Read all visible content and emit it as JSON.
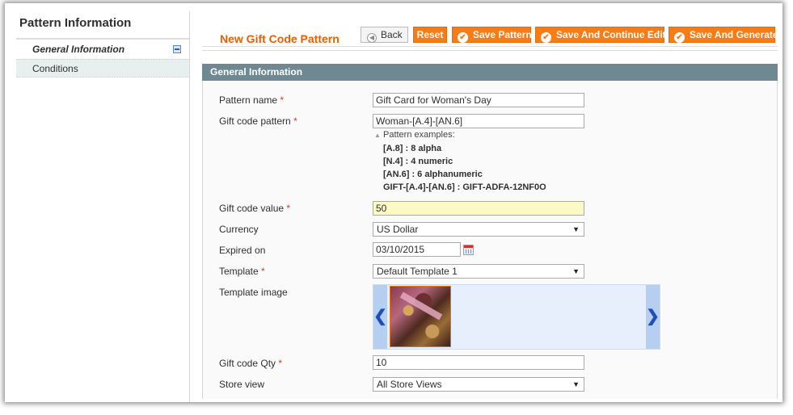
{
  "sidebar": {
    "title": "Pattern Information",
    "items": [
      {
        "label": "General Information"
      },
      {
        "label": "Conditions"
      }
    ]
  },
  "header": {
    "title": "New Gift Code Pattern",
    "buttons": {
      "back": "Back",
      "reset": "Reset",
      "save": "Save Pattern",
      "save_continue": "Save And Continue Edit",
      "save_generate": "Save And Generate"
    }
  },
  "section": {
    "title": "General Information"
  },
  "form": {
    "pattern_name": {
      "label": "Pattern name",
      "required": "*",
      "value": "Gift Card for Woman's Day"
    },
    "gift_code_pattern": {
      "label": "Gift code pattern",
      "required": "*",
      "value": "Woman-[A.4]-[AN.6]"
    },
    "pattern_examples": {
      "title": "Pattern examples:",
      "items": [
        "[A.8] : 8 alpha",
        "[N.4] : 4 numeric",
        "[AN.6] : 6 alphanumeric",
        "GIFT-[A.4]-[AN.6] : GIFT-ADFA-12NF0O"
      ]
    },
    "gift_code_value": {
      "label": "Gift code value",
      "required": "*",
      "value": "50"
    },
    "currency": {
      "label": "Currency",
      "value": "US Dollar"
    },
    "expired_on": {
      "label": "Expired on",
      "value": "03/10/2015"
    },
    "template": {
      "label": "Template",
      "required": "*",
      "value": "Default Template 1"
    },
    "template_image": {
      "label": "Template image"
    },
    "gift_code_qty": {
      "label": "Gift code Qty",
      "required": "*",
      "value": "10"
    },
    "store_view": {
      "label": "Store view",
      "value": "All Store Views"
    }
  },
  "icons": {
    "collapse": "collapse-icon",
    "calendar": "calendar-icon",
    "back": "back-arrow-icon",
    "check": "check-circle-icon",
    "carousel_prev": "chevron-left-icon",
    "carousel_next": "chevron-right-icon"
  },
  "colors": {
    "accent": "#f77c16",
    "title": "#eb5e00",
    "section_header": "#6f8992",
    "required": "#eb340a",
    "highlight_input": "#fbfac4"
  }
}
